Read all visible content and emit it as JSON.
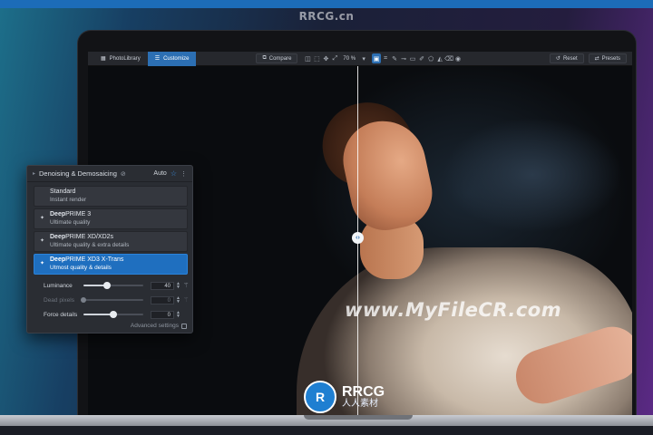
{
  "watermark_top": "RRCG.cn",
  "watermark_site": "www.MyFileCR.com",
  "watermark_logo": {
    "mark": "R",
    "title": "RRCG",
    "subtitle": "人人素材"
  },
  "toolbar": {
    "tabs": [
      {
        "label": "PhotoLibrary",
        "icon": "grid-icon"
      },
      {
        "label": "Customize",
        "icon": "sliders-icon"
      }
    ],
    "compare_label": "Compare",
    "zoom": "70 %",
    "reset_label": "Reset",
    "presets_label": "Presets"
  },
  "panel": {
    "title": "Denoising & Demosaicing",
    "mode": "Auto",
    "options": [
      {
        "brand": "",
        "name": "Standard",
        "desc": "Instant render",
        "selected": false
      },
      {
        "brand": "Deep",
        "name": "PRIME 3",
        "desc": "Ultimate quality",
        "selected": false
      },
      {
        "brand": "Deep",
        "name": "PRIME XD/XD2s",
        "desc": "Ultimate quality & extra details",
        "selected": false
      },
      {
        "brand": "Deep",
        "name": "PRIME XD3  X-Trans",
        "desc": "Utmost quality & details",
        "selected": true
      }
    ],
    "sliders": [
      {
        "label": "Luminance",
        "value": "40",
        "level": 0.4,
        "enabled": true
      },
      {
        "label": "Dead pixels",
        "value": "0",
        "level": 0,
        "enabled": false
      },
      {
        "label": "Force details",
        "value": "0",
        "level": 0.5,
        "enabled": true
      }
    ],
    "advanced_label": "Advanced settings"
  },
  "colors": {
    "accent": "#2c6fb3",
    "selected_option": "#1f6fbf",
    "panel_bg": "#2a2d33"
  }
}
